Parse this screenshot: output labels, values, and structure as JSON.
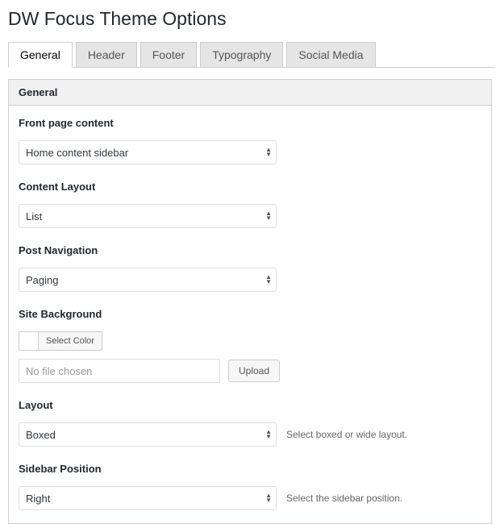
{
  "page": {
    "title": "DW Focus Theme Options"
  },
  "tabs": {
    "general": "General",
    "header": "Header",
    "footer": "Footer",
    "typography": "Typography",
    "social": "Social Media"
  },
  "section": {
    "title": "General"
  },
  "fields": {
    "front_page": {
      "label": "Front page content",
      "value": "Home content sidebar"
    },
    "content_layout": {
      "label": "Content Layout",
      "value": "List"
    },
    "post_nav": {
      "label": "Post Navigation",
      "value": "Paging"
    },
    "site_bg": {
      "label": "Site Background",
      "select_color": "Select Color",
      "file_placeholder": "No file chosen",
      "upload": "Upload"
    },
    "layout": {
      "label": "Layout",
      "value": "Boxed",
      "desc": "Select boxed or wide layout."
    },
    "sidebar_pos": {
      "label": "Sidebar Position",
      "value": "Right",
      "desc": "Select the sidebar position."
    }
  }
}
